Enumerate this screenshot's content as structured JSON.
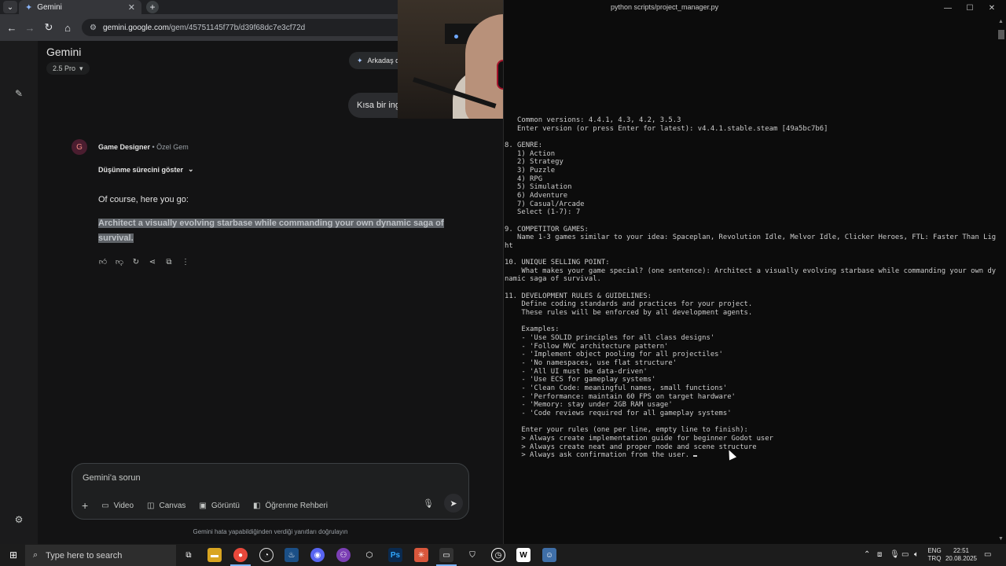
{
  "browser": {
    "tab_title": "Gemini",
    "url_host": "gemini.google.com",
    "url_path": "/gem/45751145f77b/d39f68dc7e3cf72d"
  },
  "gemini": {
    "title": "Gemini",
    "model": "2.5 Pro",
    "share_chip": "Arkadaş d",
    "user_message": "Kısa bir ing",
    "gem_name": "Game Designer",
    "gem_type": " • Özel Gem",
    "thinking_toggle": "Düşünme sürecini göster",
    "answer_intro": "Of course, here you go:",
    "answer_highlight": "Architect a visually evolving starbase while commanding your own dynamic saga of survival.",
    "composer": {
      "placeholder": "Gemini'a sorun",
      "tools": [
        "Video",
        "Canvas",
        "Görüntü",
        "Öğrenme Rehberi"
      ]
    },
    "disclaimer": "Gemini hata yapabildiğinden verdiği yanıtları doğrulayın",
    "icons": {
      "new_chat": "edit-icon",
      "settings": "gear-icon",
      "actions": [
        "thumbs-up-icon",
        "thumbs-down-icon",
        "refresh-icon",
        "share-icon",
        "copy-icon",
        "more-icon"
      ]
    }
  },
  "terminal": {
    "title": "python  scripts/project_manager.py",
    "lines": [
      "   Common versions: 4.4.1, 4.3, 4.2, 3.5.3",
      "   Enter version (or press Enter for latest): v4.4.1.stable.steam [49a5bc7b6]",
      "",
      "8. GENRE:",
      "   1) Action",
      "   2) Strategy",
      "   3) Puzzle",
      "   4) RPG",
      "   5) Simulation",
      "   6) Adventure",
      "   7) Casual/Arcade",
      "   Select (1-7): 7",
      "",
      "9. COMPETITOR GAMES:",
      "   Name 1-3 games similar to your idea: Spaceplan, Revolution Idle, Melvor Idle, Clicker Heroes, FTL: Faster Than Lig",
      "ht",
      "",
      "10. UNIQUE SELLING POINT:",
      "    What makes your game special? (one sentence): Architect a visually evolving starbase while commanding your own dy",
      "namic saga of survival.",
      "",
      "11. DEVELOPMENT RULES & GUIDELINES:",
      "    Define coding standards and practices for your project.",
      "    These rules will be enforced by all development agents.",
      "",
      "    Examples:",
      "    - 'Use SOLID principles for all class designs'",
      "    - 'Follow MVC architecture pattern'",
      "    - 'Implement object pooling for all projectiles'",
      "    - 'No namespaces, use flat structure'",
      "    - 'All UI must be data-driven'",
      "    - 'Use ECS for gameplay systems'",
      "    - 'Clean Code: meaningful names, small functions'",
      "    - 'Performance: maintain 60 FPS on target hardware'",
      "    - 'Memory: stay under 2GB RAM usage'",
      "    - 'Code reviews required for all gameplay systems'",
      "",
      "    Enter your rules (one per line, empty line to finish):",
      "    > Always create implementation guide for beginner Godot user",
      "    > Always create neat and proper node and scene structure",
      "    > Always ask confirmation from the user. "
    ]
  },
  "taskbar": {
    "search_placeholder": "Type here to search",
    "language": "ENG",
    "keyboard": "TRQ",
    "time": "22:51",
    "date": "20.08.2025"
  }
}
